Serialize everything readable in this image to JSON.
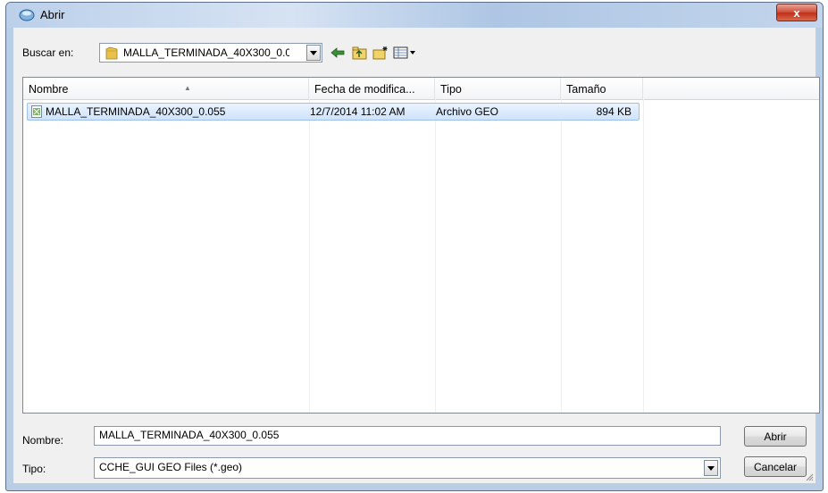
{
  "window": {
    "title": "Abrir",
    "close_label": "x"
  },
  "lookin": {
    "label": "Buscar en:",
    "value": "MALLA_TERMINADA_40X300_0.0"
  },
  "toolbar_icons": [
    "back-arrow-icon",
    "up-folder-icon",
    "new-folder-icon",
    "view-menu-icon"
  ],
  "filelist": {
    "columns": [
      "Nombre",
      "Fecha de modifica...",
      "Tipo",
      "Tamaño"
    ],
    "rows": [
      {
        "name": "MALLA_TERMINADA_40X300_0.055",
        "date": "12/7/2014 11:02 AM",
        "type": "Archivo GEO",
        "size": "894 KB"
      }
    ]
  },
  "filename": {
    "label": "Nombre:",
    "value": "MALLA_TERMINADA_40X300_0.055"
  },
  "filetype": {
    "label": "Tipo:",
    "value": "CCHE_GUI GEO Files (*.geo)"
  },
  "buttons": {
    "open": "Abrir",
    "cancel": "Cancelar"
  },
  "colors": {
    "selection_border": "#9ec1e8",
    "close_button": "#c1301a"
  }
}
